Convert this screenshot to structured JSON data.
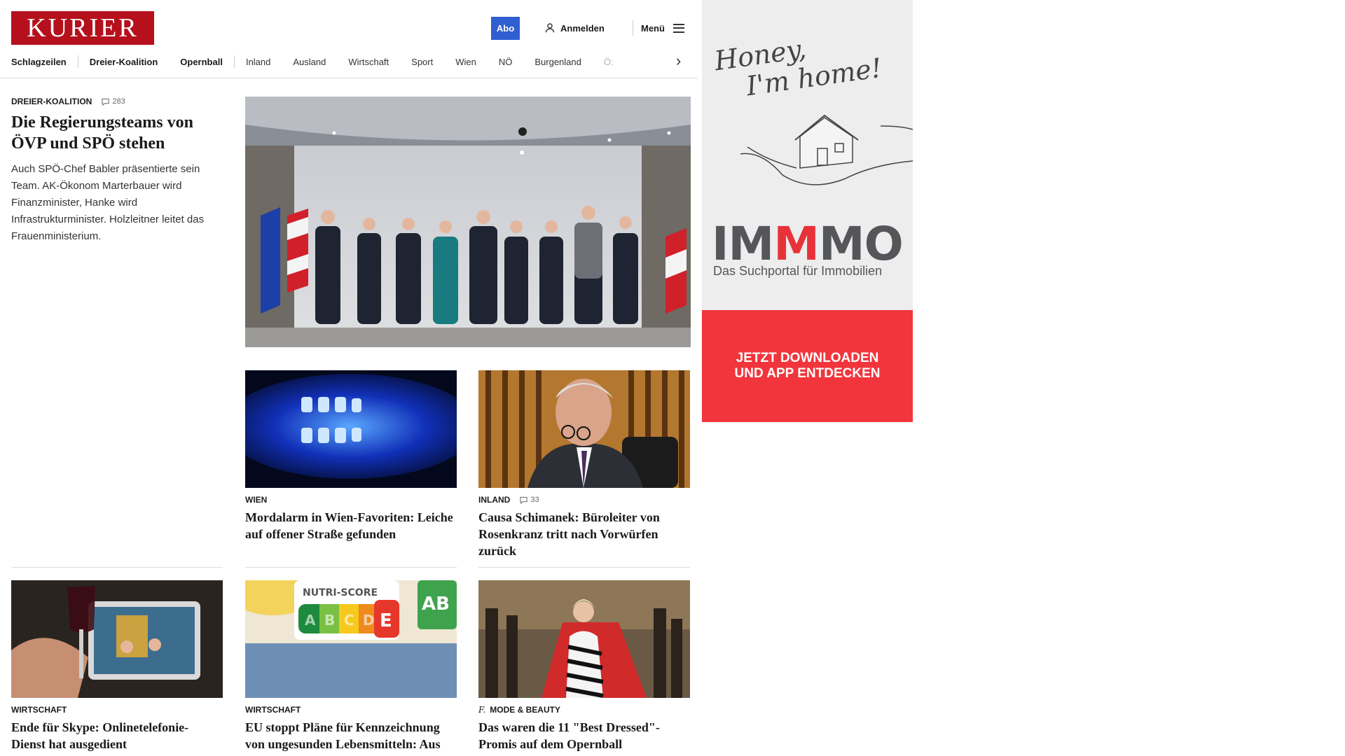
{
  "header": {
    "logo": "KURIER",
    "abo_label": "Abo",
    "login_label": "Anmelden",
    "menu_label": "Menü",
    "nav": [
      {
        "label": "Schlagzeilen"
      },
      {
        "label": "Dreier-Koalition"
      },
      {
        "label": "Opernball"
      },
      {
        "label": "Inland"
      },
      {
        "label": "Ausland"
      },
      {
        "label": "Wirtschaft"
      },
      {
        "label": "Sport"
      },
      {
        "label": "Wien"
      },
      {
        "label": "NÖ"
      },
      {
        "label": "Burgenland"
      },
      {
        "label": "Ö:"
      }
    ]
  },
  "lead": {
    "kicker": "DREIER-KOALITION",
    "comments": "283",
    "title": "Die Regierungsteams von ÖVP und SPÖ stehen",
    "text": "Auch SPÖ-Chef Babler präsentierte sein Team. AK-Ökonom Marterbauer wird Finanzminister, Hanke wird Infrastrukturminister. Holzleitner leitet das Frauenministerium."
  },
  "cards": [
    {
      "kicker": "WIEN",
      "title": "Mordalarm in Wien-Favoriten: Leiche auf offener Straße gefunden"
    },
    {
      "kicker": "INLAND",
      "comments": "33",
      "title": "Causa Schimanek: Büroleiter von Rosenkranz tritt nach Vorwürfen zurück"
    },
    {
      "kicker": "WIRTSCHAFT",
      "title": "Ende für Skype: Onlinetelefonie-Dienst hat ausgedient"
    },
    {
      "kicker": "WIRTSCHAFT",
      "title": "EU stoppt Pläne für Kennzeichnung von ungesunden Lebensmitteln: Aus für Nutri-Score"
    },
    {
      "kicker": "MODE & BEAUTY",
      "brand_prefix": "f.",
      "title": "Das waren die 11 \"Best Dressed\"-Promis auf dem Opernball"
    }
  ],
  "nutri": {
    "label": "NUTRI-SCORE",
    "grades": [
      "A",
      "B",
      "C",
      "D",
      "E"
    ],
    "bio": "AB"
  },
  "ad": {
    "tagline_1": "Honey,",
    "tagline_2": "I'm home!",
    "brand_a": "IM",
    "brand_b": "M",
    "brand_c": "MO",
    "subline": "Das Suchportal für Immobilien",
    "cta_1": "JETZT DOWNLOADEN",
    "cta_2": "UND APP ENTDECKEN"
  },
  "colors": {
    "brand_red": "#b5101c",
    "abo_blue": "#2f5fd0",
    "ad_red": "#f2353c",
    "immmo_red": "#e8323a"
  }
}
